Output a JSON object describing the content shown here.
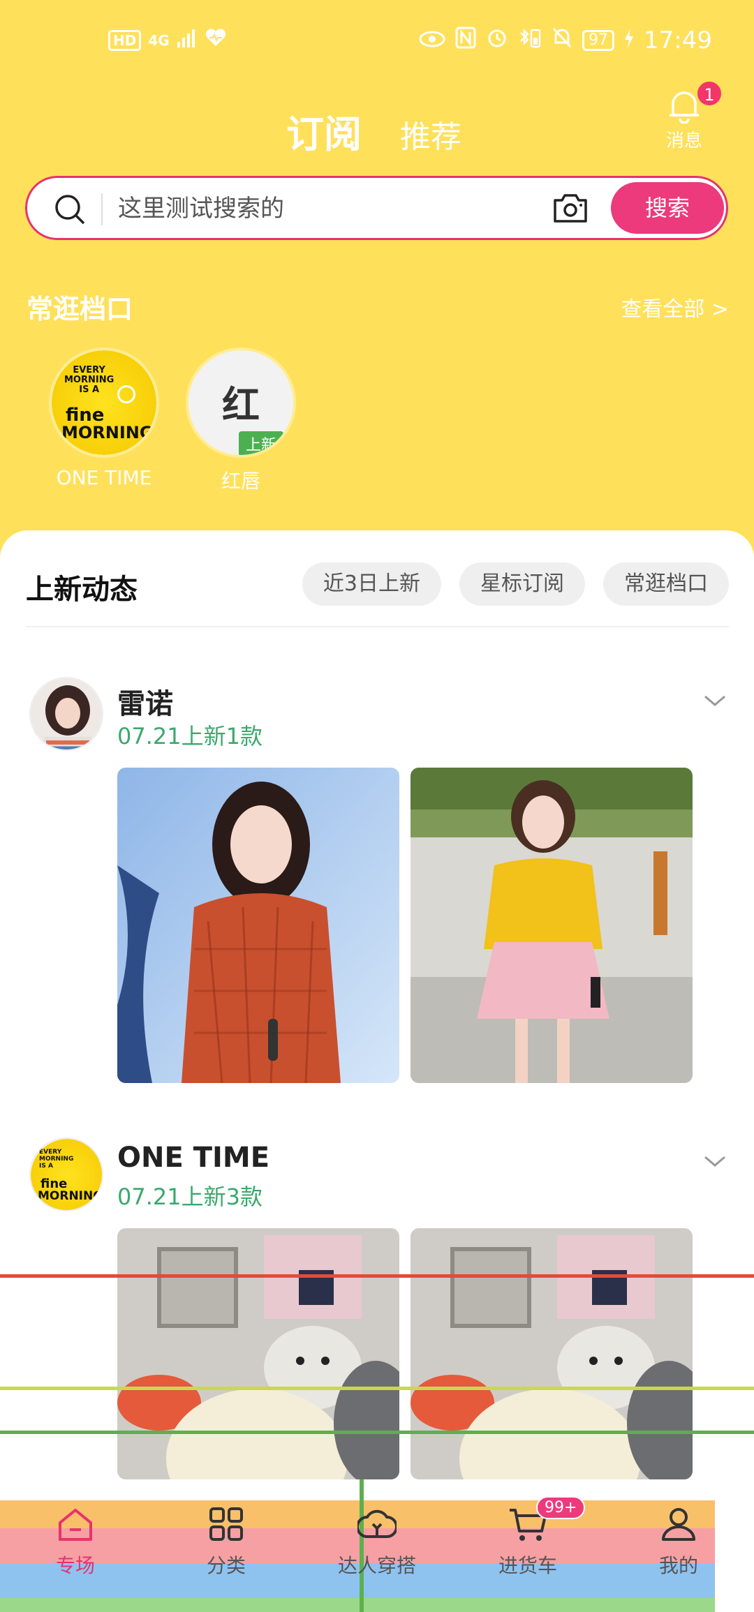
{
  "status_bar": {
    "left_badges": [
      "HD",
      "4G"
    ],
    "battery": "97",
    "time": "17:49"
  },
  "header": {
    "tabs": [
      {
        "label": "订阅",
        "active": true
      },
      {
        "label": "推荐",
        "active": false
      }
    ],
    "notifications": {
      "label": "消息",
      "count": "1"
    }
  },
  "search": {
    "placeholder": "这里测试搜索的",
    "button_label": "搜索"
  },
  "frequent_stalls": {
    "title": "常逛档口",
    "view_all": "查看全部 >",
    "items": [
      {
        "name": "ONE TIME",
        "logo_lines": [
          "EVERY",
          "MORNING",
          "IS A"
        ],
        "logo_main": "fine",
        "logo_sub": "MORNING"
      },
      {
        "name": "红唇",
        "avatar_char": "红",
        "tag": "上新"
      }
    ]
  },
  "feed": {
    "title": "上新动态",
    "filters": [
      "近3日上新",
      "星标订阅",
      "常逛档口"
    ],
    "items": [
      {
        "name": "雷诺",
        "meta": "07.21上新1款"
      },
      {
        "name": "ONE TIME",
        "meta": "07.21上新3款"
      }
    ]
  },
  "bottom_nav": {
    "items": [
      {
        "label": "专场",
        "icon": "home-icon",
        "active": true
      },
      {
        "label": "分类",
        "icon": "grid-icon",
        "active": false
      },
      {
        "label": "达人穿搭",
        "icon": "hanger-icon",
        "active": false
      },
      {
        "label": "进货车",
        "icon": "cart-icon",
        "active": false,
        "badge": "99+"
      },
      {
        "label": "我的",
        "icon": "user-icon",
        "active": false
      }
    ]
  },
  "colors": {
    "header_bg": "#FFE05A",
    "accent": "#EC3A7C",
    "meta_green": "#3BA86D"
  }
}
